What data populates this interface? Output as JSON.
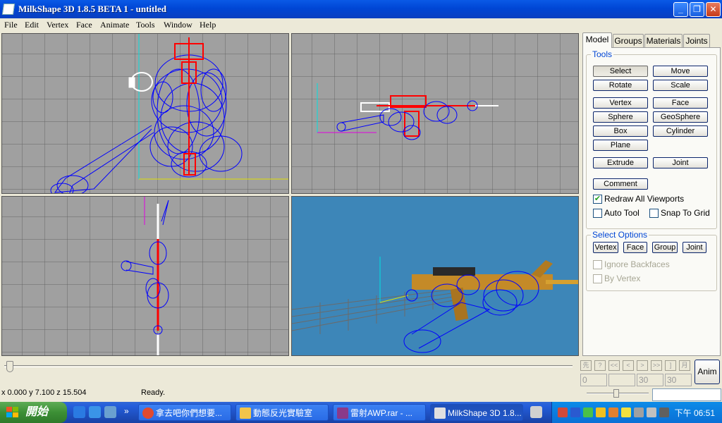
{
  "window": {
    "title": "MilkShape 3D 1.8.5 BETA 1 - untitled"
  },
  "menu": [
    "File",
    "Edit",
    "Vertex",
    "Face",
    "Animate",
    "Tools",
    "Window",
    "Help"
  ],
  "panel": {
    "tabs": [
      "Model",
      "Groups",
      "Materials",
      "Joints"
    ],
    "tools_title": "Tools",
    "tools": {
      "select": "Select",
      "move": "Move",
      "rotate": "Rotate",
      "scale": "Scale",
      "vertex": "Vertex",
      "face": "Face",
      "sphere": "Sphere",
      "geosphere": "GeoSphere",
      "box": "Box",
      "cylinder": "Cylinder",
      "plane": "Plane",
      "extrude": "Extrude",
      "joint": "Joint",
      "comment": "Comment"
    },
    "redraw_all": "Redraw All Viewports",
    "auto_tool": "Auto Tool",
    "snap_to_grid": "Snap To Grid",
    "select_options_title": "Select Options",
    "select_options": [
      "Vertex",
      "Face",
      "Group",
      "Joint"
    ],
    "ignore_backfaces": "Ignore Backfaces",
    "by_vertex": "By Vertex"
  },
  "timeline": {
    "buttons": [
      "先",
      "?",
      "<<",
      "<",
      ">",
      ">>",
      "]",
      "月"
    ],
    "fields": [
      "0",
      "",
      "30",
      "30"
    ],
    "anim_label": "Anim"
  },
  "status": {
    "coords": "x 0.000 y 7.100 z 15.504",
    "text": "Ready."
  },
  "taskbar": {
    "start_label": "開始",
    "tasks": [
      "拿去吧你們想要...",
      "動態反光實驗室",
      "雷射AWP.rar - ...",
      "MilkShape 3D 1.8..."
    ],
    "clock": "下午 06:51"
  },
  "colors": {
    "titlebar": "#0a52de",
    "viewport_grid": "#a0a0a0",
    "perspective_bg": "#3d86b8",
    "wire_blue": "#0000ff",
    "wire_red": "#ff0000",
    "accent": "#0046d5"
  }
}
